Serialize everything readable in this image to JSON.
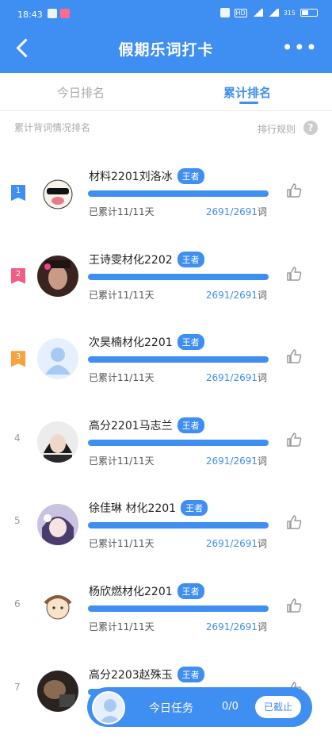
{
  "status_bar": {
    "time": "18:43",
    "battery": "315"
  },
  "header": {
    "title": "假期乐词打卡",
    "more": "•••"
  },
  "tabs": [
    {
      "label": "今日排名",
      "active": false
    },
    {
      "label": "累计排名",
      "active": true
    }
  ],
  "subhead": {
    "left": "累计背词情况排名",
    "rule": "排行规则",
    "help": "?"
  },
  "rows": [
    {
      "rank": "1",
      "rank_color": "#3f8ef1",
      "name": "材料2201刘洛冰",
      "tag": "王者",
      "days": "已累计11/11天",
      "words": "2691/2691",
      "unit": "词",
      "progress": 1.0,
      "avatar": "dog"
    },
    {
      "rank": "2",
      "rank_color": "#f25d86",
      "name": "王诗雯材化2202",
      "tag": "王者",
      "days": "已累计11/11天",
      "words": "2691/2691",
      "unit": "词",
      "progress": 1.0,
      "avatar": "dark"
    },
    {
      "rank": "3",
      "rank_color": "#f7a23c",
      "name": "次昊楠材化2201",
      "tag": "王者",
      "days": "已累计11/11天",
      "words": "2691/2691",
      "unit": "词",
      "progress": 1.0,
      "avatar": "default"
    },
    {
      "rank": "4",
      "name": "高分2201马志兰",
      "tag": "王者",
      "days": "已累计11/11天",
      "words": "2691/2691",
      "unit": "词",
      "progress": 1.0,
      "avatar": "person"
    },
    {
      "rank": "5",
      "name": "徐佳琳 材化2201",
      "tag": "王者",
      "days": "已累计11/11天",
      "words": "2691/2691",
      "unit": "词",
      "progress": 1.0,
      "avatar": "anime"
    },
    {
      "rank": "6",
      "name": "杨欣燃材化2201",
      "tag": "王者",
      "days": "已累计11/11天",
      "words": "2691/2691",
      "unit": "词",
      "progress": 1.0,
      "avatar": "cartoon"
    },
    {
      "rank": "7",
      "name": "高分2203赵殊玉",
      "tag": "王者",
      "days": "",
      "words": "",
      "unit": "",
      "progress": 1.0,
      "avatar": "photo"
    }
  ],
  "task_bar": {
    "label": "今日任务",
    "count": "0/0",
    "button": "已截止"
  },
  "colors": {
    "primary": "#3f8ef1"
  }
}
